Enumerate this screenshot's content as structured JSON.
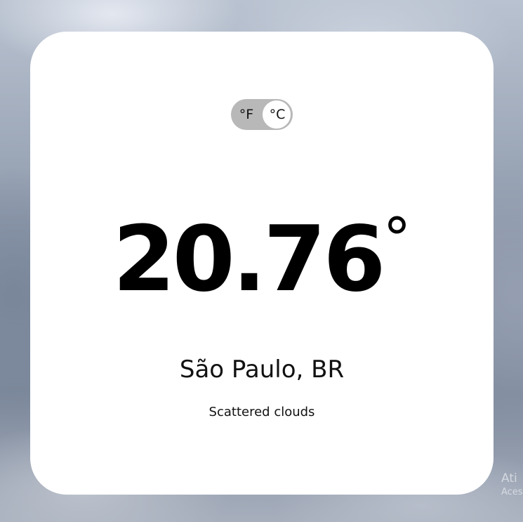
{
  "units": {
    "fahrenheit_label": "°F",
    "celsius_label": "°C",
    "selected": "celsius"
  },
  "weather": {
    "temperature": "20.76",
    "degree_symbol": "°",
    "location": "São Paulo, BR",
    "description": "Scattered clouds"
  },
  "watermark": {
    "line1": "Ati",
    "line2": "Aces"
  },
  "colors": {
    "card_background": "#ffffff",
    "toggle_track": "#b8b8b8",
    "text": "#000000"
  }
}
